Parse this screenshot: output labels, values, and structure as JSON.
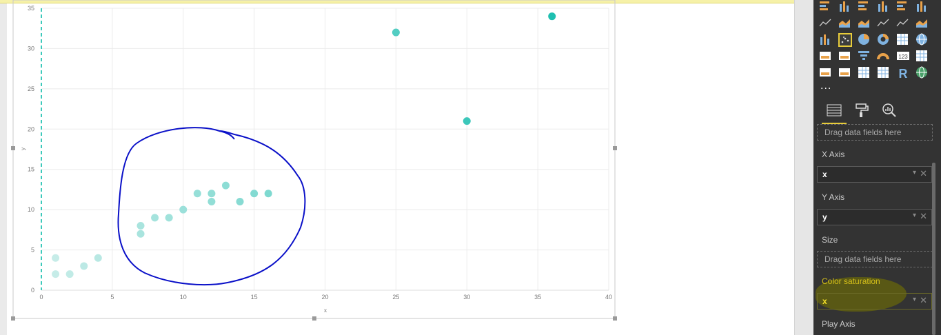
{
  "visual": {
    "chart_data": {
      "type": "scatter",
      "xlabel": "x",
      "ylabel": "y",
      "xlim": [
        0,
        40
      ],
      "ylim": [
        0,
        35
      ],
      "x_ticks": [
        0,
        5,
        10,
        15,
        20,
        25,
        30,
        35,
        40
      ],
      "y_ticks": [
        0,
        5,
        10,
        15,
        20,
        25,
        30,
        35
      ],
      "grid": true,
      "color_saturation_by": "x",
      "color_light": "#c6ece8",
      "color_dark": "#1fbfb0",
      "reference_line_color": "#3cc9bb",
      "points": [
        {
          "x": 1,
          "y": 4
        },
        {
          "x": 1,
          "y": 2
        },
        {
          "x": 2,
          "y": 2
        },
        {
          "x": 3,
          "y": 3
        },
        {
          "x": 4,
          "y": 4
        },
        {
          "x": 7,
          "y": 8
        },
        {
          "x": 7,
          "y": 7
        },
        {
          "x": 8,
          "y": 9
        },
        {
          "x": 9,
          "y": 9
        },
        {
          "x": 10,
          "y": 10
        },
        {
          "x": 11,
          "y": 12
        },
        {
          "x": 12,
          "y": 12
        },
        {
          "x": 12,
          "y": 11
        },
        {
          "x": 13,
          "y": 13
        },
        {
          "x": 14,
          "y": 11
        },
        {
          "x": 15,
          "y": 12
        },
        {
          "x": 16,
          "y": 12
        },
        {
          "x": 25,
          "y": 32
        },
        {
          "x": 30,
          "y": 21
        },
        {
          "x": 36,
          "y": 34
        }
      ],
      "annotation_color": "#0a10c8"
    }
  },
  "panel": {
    "ellipsis": "...",
    "viz_icons": [
      [
        "stacked-bar-icon",
        "stacked-column-icon",
        "clustered-bar-icon",
        "clustered-column-icon",
        "100pct-bar-icon",
        "100pct-column-icon"
      ],
      [
        "line-chart-icon",
        "area-chart-icon",
        "stacked-area-icon",
        "line-column-icon",
        "line-clustered-column-icon",
        "ribbon-chart-icon"
      ],
      [
        "waterfall-icon",
        "scatter-chart-icon",
        "pie-chart-icon",
        "donut-chart-icon",
        "treemap-icon",
        "map-icon"
      ],
      [
        "filled-map-icon",
        "shape-map-icon",
        "funnel-icon",
        "gauge-icon",
        "card-icon",
        "multi-row-card-icon"
      ],
      [
        "kpi-icon",
        "slicer-icon",
        "table-icon",
        "matrix-icon",
        "r-visual-icon",
        "globe-icon"
      ]
    ],
    "card_label": "123",
    "r_label": "R",
    "tabs": [
      "fields-tab",
      "format-tab",
      "analytics-tab"
    ],
    "wells": {
      "details_placeholder": "Drag data fields here",
      "x_axis_label": "X Axis",
      "x_axis_field": "x",
      "y_axis_label": "Y Axis",
      "y_axis_field": "y",
      "size_label": "Size",
      "size_placeholder": "Drag data fields here",
      "color_saturation_label": "Color saturation",
      "color_saturation_field": "x",
      "play_axis_label": "Play Axis",
      "dropdown_glyph": "▾",
      "remove_glyph": "✕"
    }
  }
}
